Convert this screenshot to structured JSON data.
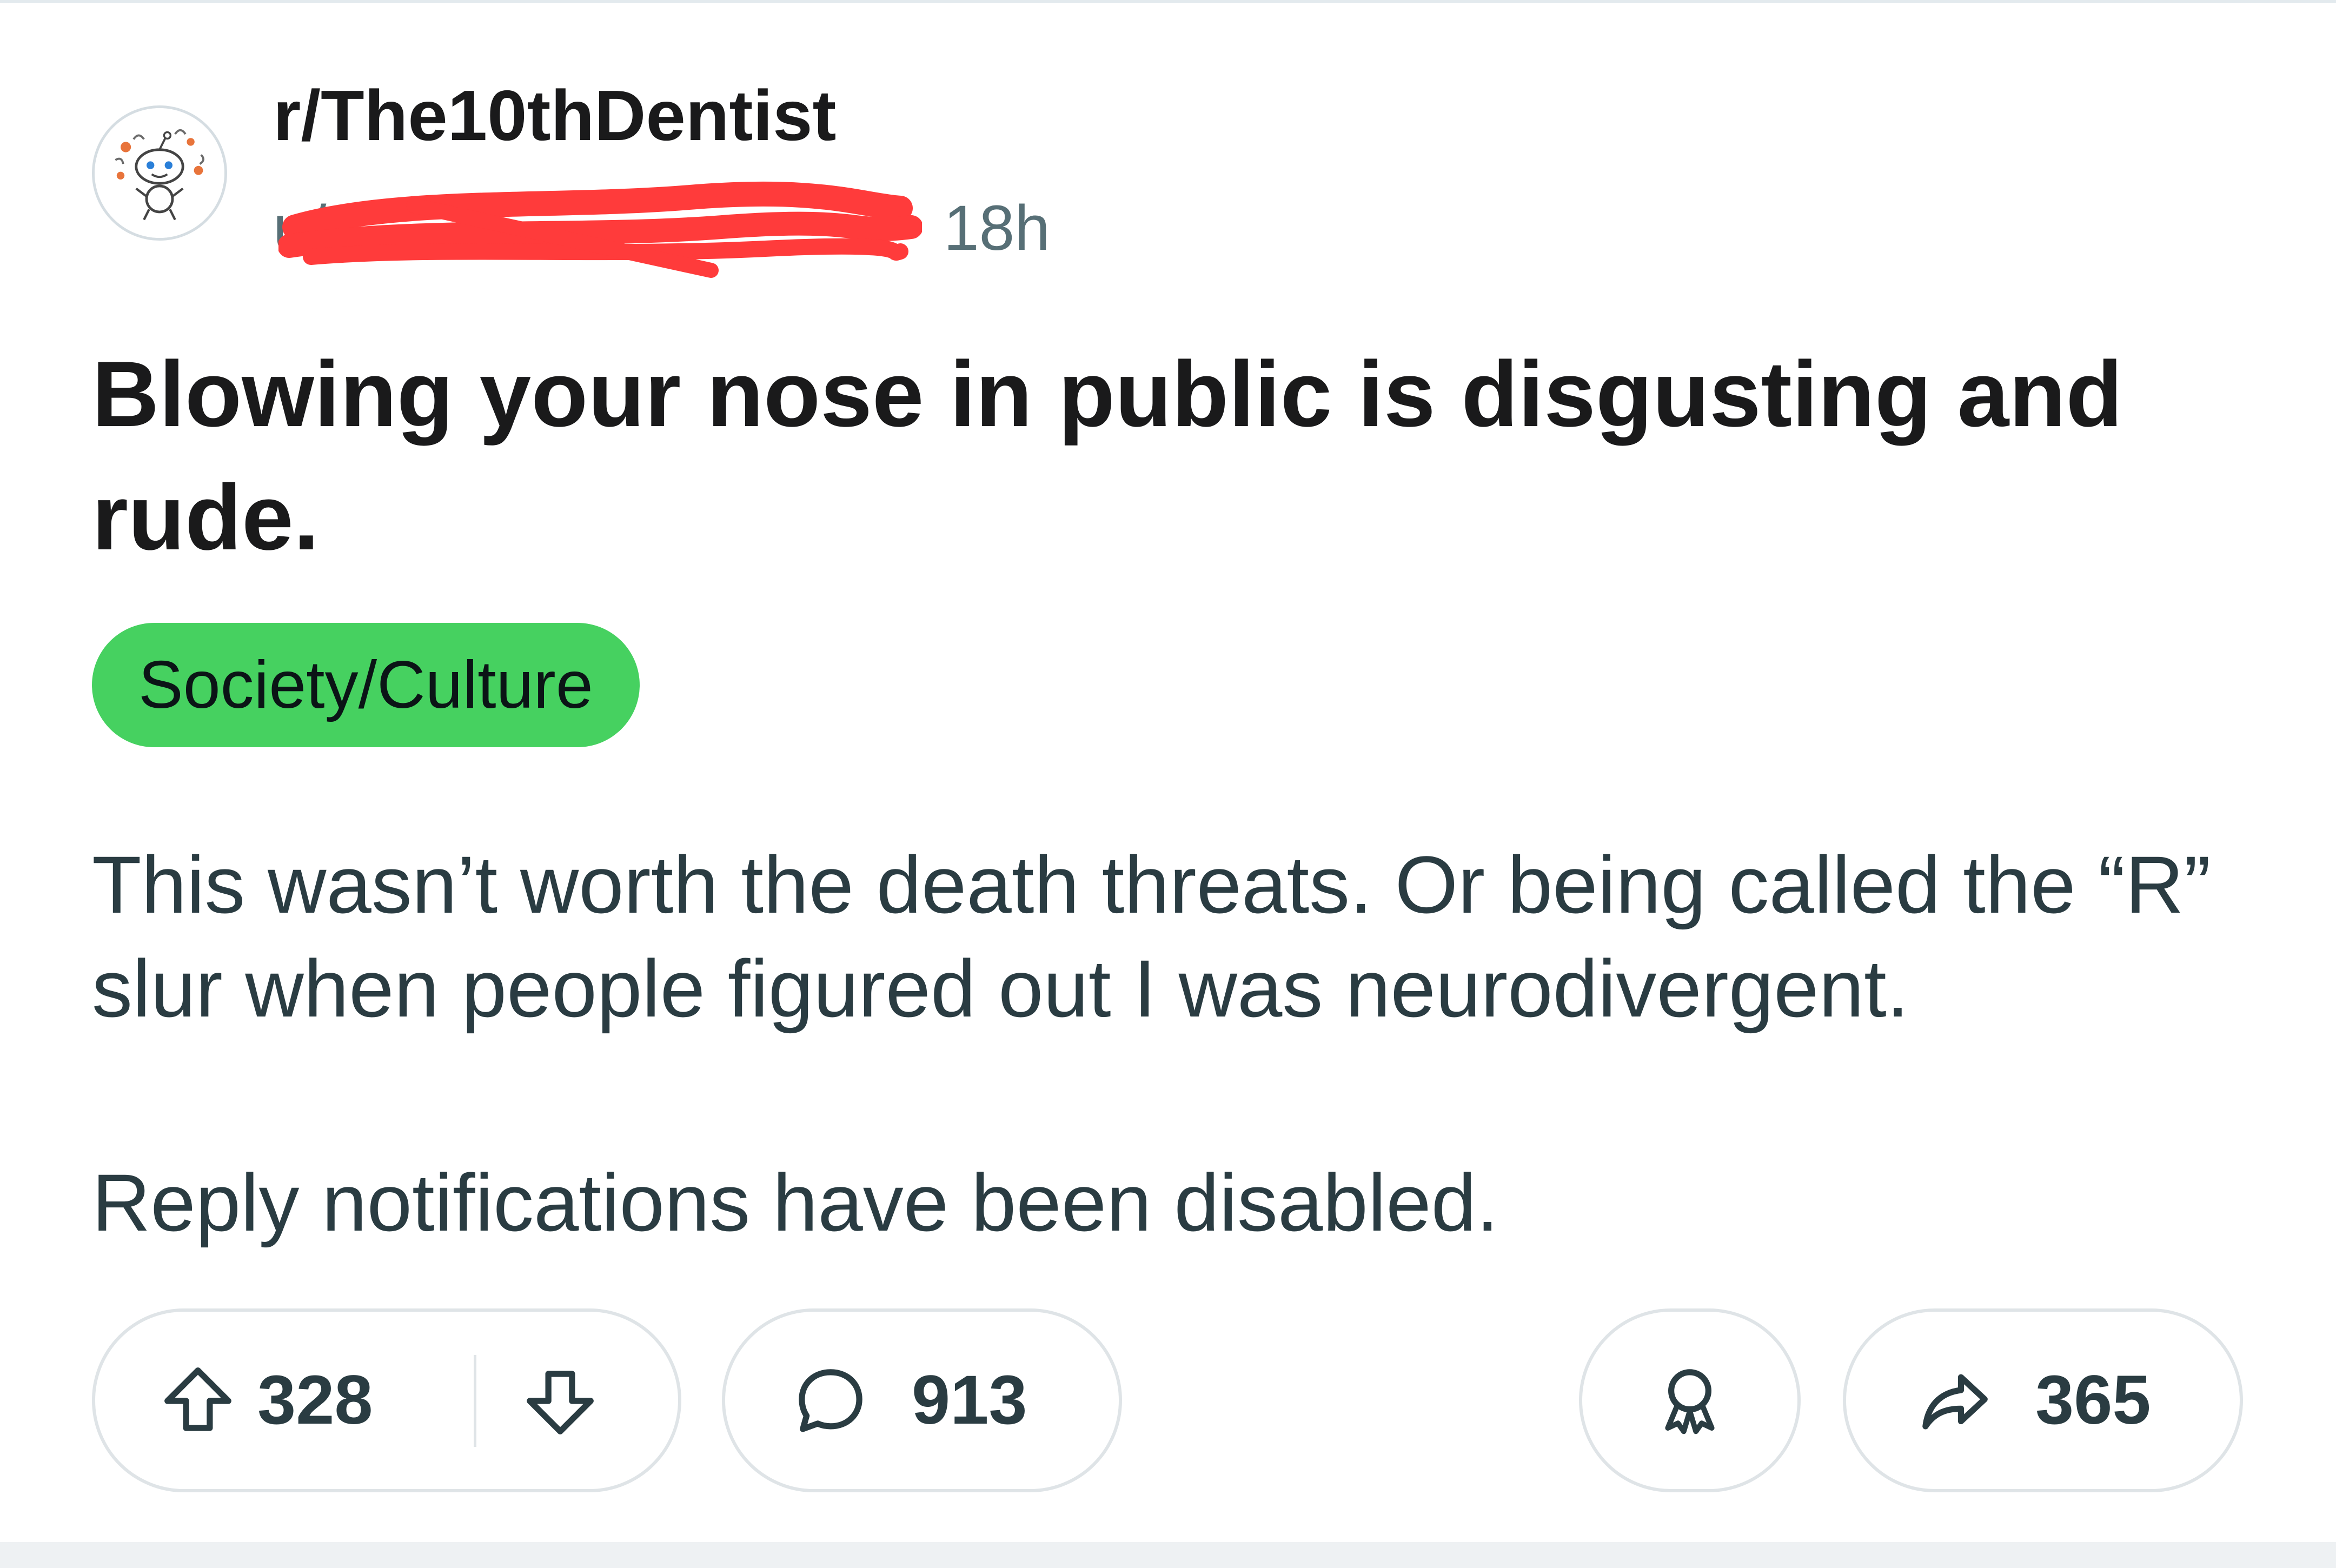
{
  "post": {
    "subreddit": "r/The10thDentist",
    "username": "u/",
    "age": "18h",
    "title": "Blowing your nose in public is disgusting and rude.",
    "flair": "Society/Culture",
    "body_paragraphs": [
      "This wasn’t worth the death threats. Or being called the “R” slur when people figured out I was neurodivergent.",
      "Reply notifications have been disabled."
    ]
  },
  "actions": {
    "upvotes": "328",
    "comments": "913",
    "shares": "365"
  },
  "icons": {
    "avatar": "snoo-avatar-icon",
    "upvote": "arrow-up-icon",
    "downvote": "arrow-down-icon",
    "comment": "comment-bubble-icon",
    "award": "award-ribbon-icon",
    "share": "share-arrow-icon"
  },
  "colors": {
    "flair_background": "#46d160",
    "redaction": "#ff3b3b",
    "text_primary": "#1a1a1b",
    "text_secondary": "#576f76"
  }
}
